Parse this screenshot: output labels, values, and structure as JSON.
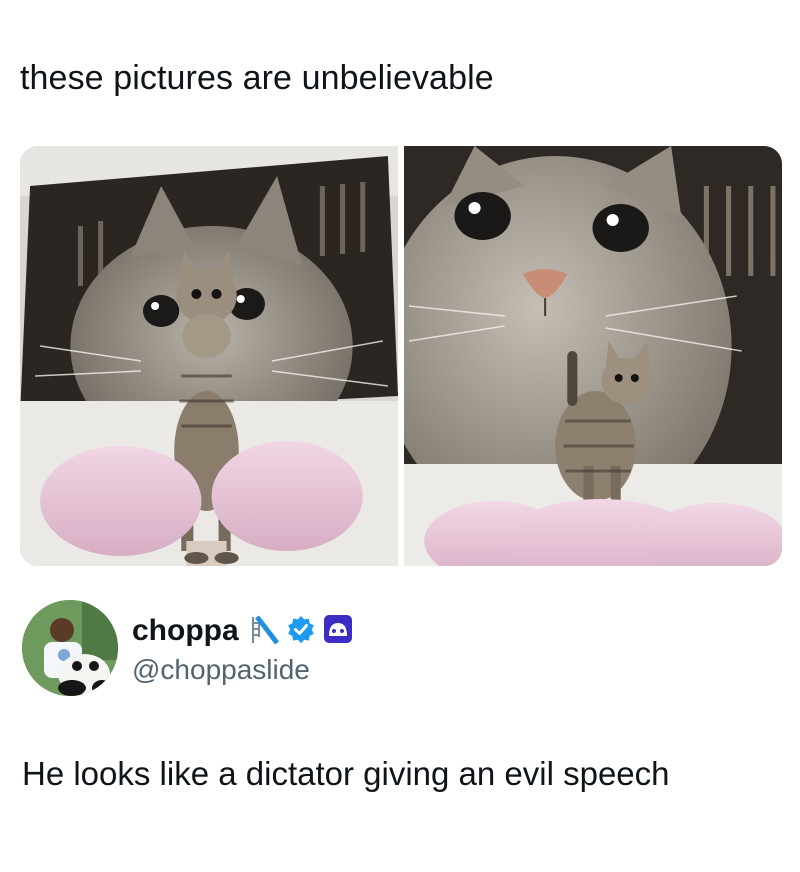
{
  "post": {
    "caption": "these pictures are unbelievable"
  },
  "photos": [
    {
      "name": "cat-photo-1",
      "subject": "tabby cat standing on pink cat tree in front of giant cat poster"
    },
    {
      "name": "cat-photo-2",
      "subject": "tabby cat sitting on pink cat tree in front of giant cat poster close-up"
    }
  ],
  "tweet": {
    "display_name": "choppa",
    "handle": "@choppaslide",
    "text": "He looks like a dictator giving an evil speech",
    "icons": [
      "slide-emoji-icon",
      "verified-badge-icon",
      "game-controller-badge-icon"
    ]
  },
  "colors": {
    "verified": "#1d9bf0",
    "handle": "#536471",
    "text": "#0f1419",
    "cushion": "#e7c6d8"
  }
}
